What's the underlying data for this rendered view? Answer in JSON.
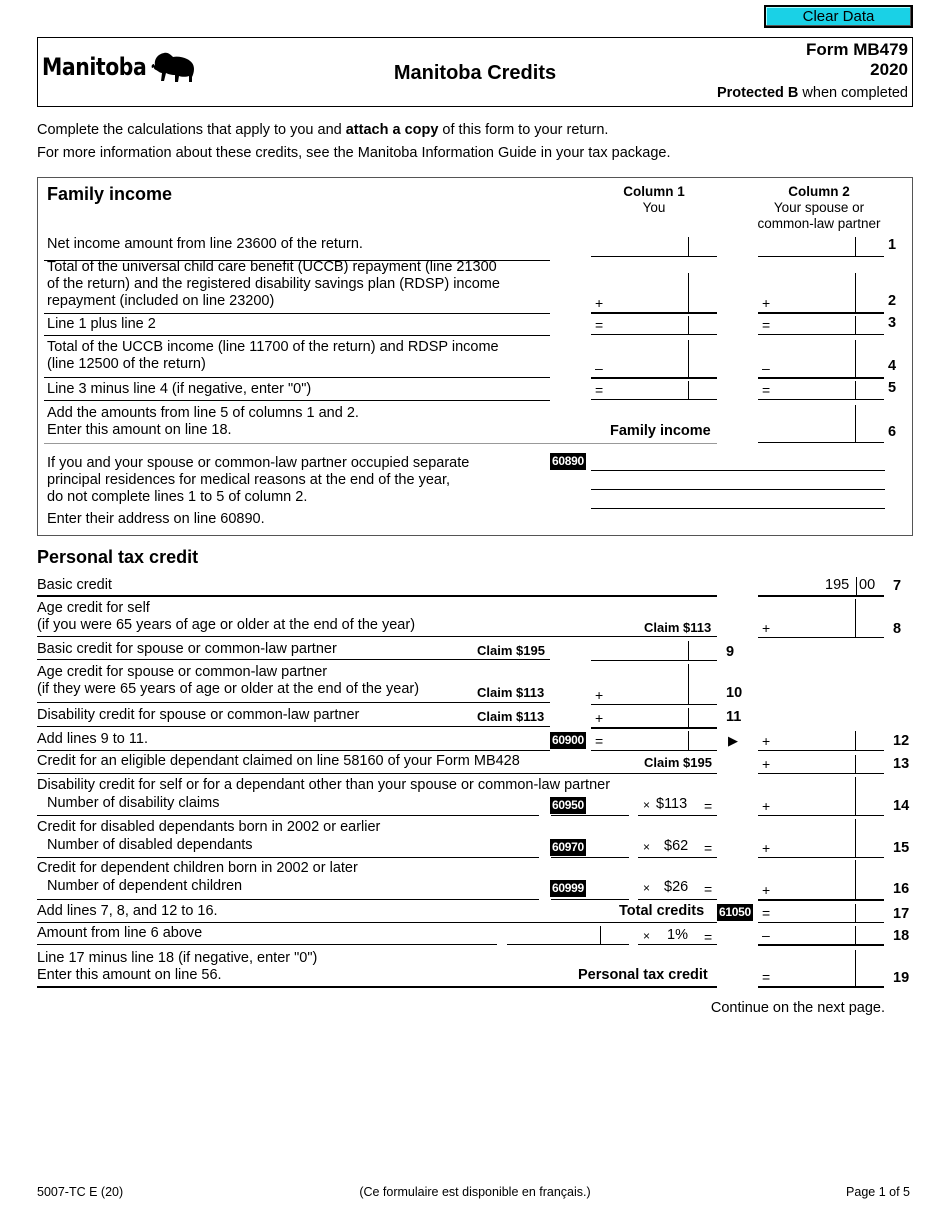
{
  "toolbar": {
    "clear_label": "Clear Data"
  },
  "header": {
    "logo_text": "Manitoba",
    "title": "Manitoba Credits",
    "form_number": "Form MB479",
    "year": "2020",
    "protected_bold": "Protected B",
    "protected_rest": " when completed"
  },
  "intro": {
    "line1_pre": "Complete the calculations that apply to you and ",
    "line1_bold": "attach a copy",
    "line1_post": " of this form to your return.",
    "line2": "For more information about these credits, see the Manitoba Information Guide in your tax package."
  },
  "family": {
    "title": "Family income",
    "col1_title": "Column 1",
    "col1_sub": "You",
    "col2_title": "Column 2",
    "col2_sub1": "Your spouse or",
    "col2_sub2": "common-law partner",
    "lines": [
      {
        "num": "1",
        "text": [
          "Net income amount from line 23600 of the return."
        ],
        "op": "",
        "col1": "",
        "col2": ""
      },
      {
        "num": "2",
        "text": [
          "Total of the universal child care benefit (UCCB) repayment (line 21300",
          "of the return) and the registered disability savings plan (RDSP) income",
          "repayment (included on line 23200)"
        ],
        "op": "+",
        "col1": "",
        "col2": ""
      },
      {
        "num": "3",
        "text": [
          "Line 1 plus line 2"
        ],
        "op": "=",
        "col1": "",
        "col2": ""
      },
      {
        "num": "4",
        "text": [
          "Total of the UCCB income (line 11700 of the return) and RDSP income",
          "(line 12500 of the return)"
        ],
        "op": "–",
        "col1": "",
        "col2": ""
      },
      {
        "num": "5",
        "text": [
          "Line 3 minus line 4 (if negative, enter \"0\")"
        ],
        "op": "=",
        "col1": "",
        "col2": ""
      },
      {
        "num": "6",
        "text": [
          "Add the amounts from line 5 of columns 1 and 2.",
          "Enter this amount on line 18."
        ],
        "label": "Family income",
        "value": ""
      }
    ],
    "separate": {
      "text": [
        "If you and your spouse or common-law partner occupied separate",
        "principal residences for medical reasons at the end of the year,",
        "do not complete lines 1 to 5 of column 2."
      ],
      "text2": "Enter their address on line 60890.",
      "code": "60890",
      "address_lines": [
        "",
        "",
        ""
      ]
    }
  },
  "personal": {
    "title": "Personal tax credit",
    "line7": {
      "num": "7",
      "text": "Basic credit",
      "dollars": "195",
      "cents": "00"
    },
    "line8": {
      "num": "8",
      "text": [
        "Age credit for self",
        "(if you were 65 years of age or older at the end of the year)"
      ],
      "claim": "Claim $113",
      "op": "+",
      "value": ""
    },
    "line9": {
      "num": "9",
      "text": "Basic credit for spouse or common-law partner",
      "claim": "Claim $195",
      "value": ""
    },
    "line10": {
      "num": "10",
      "text": [
        "Age credit for spouse or common-law partner",
        "(if they were 65 years of age or older at the end of the year)"
      ],
      "claim": "Claim $113",
      "op": "+",
      "value": ""
    },
    "line11": {
      "num": "11",
      "text": "Disability credit for spouse or common-law partner",
      "claim": "Claim $113",
      "op": "+",
      "value": ""
    },
    "line12": {
      "num": "12",
      "text": "Add lines 9 to 11.",
      "code": "60900",
      "op": "=",
      "arrow": "▶",
      "op2": "+",
      "value": "",
      "value2": ""
    },
    "line13": {
      "num": "13",
      "text": "Credit for an eligible dependant claimed on line 58160 of your Form MB428",
      "claim": "Claim $195",
      "op": "+",
      "value": ""
    },
    "line14": {
      "num": "14",
      "text": "Disability credit for self or for a dependant other than your spouse or common-law partner",
      "sub": "Number of disability claims",
      "code": "60950",
      "mult": "×",
      "rate": "$113",
      "eq": "=",
      "op": "+",
      "count": "",
      "value": ""
    },
    "line15": {
      "num": "15",
      "text": "Credit for disabled dependants born in 2002 or earlier",
      "sub": "Number of disabled dependants",
      "code": "60970",
      "mult": "×",
      "rate": "$62",
      "eq": "=",
      "op": "+",
      "count": "",
      "value": ""
    },
    "line16": {
      "num": "16",
      "text": "Credit for dependent children born in 2002 or later",
      "sub": "Number of dependent children",
      "code": "60999",
      "mult": "×",
      "rate": "$26",
      "eq": "=",
      "op": "+",
      "count": "",
      "value": ""
    },
    "line17": {
      "num": "17",
      "text": "Add lines 7, 8, and 12 to 16.",
      "label": "Total credits",
      "code": "61050",
      "op": "=",
      "value": ""
    },
    "line18": {
      "num": "18",
      "text": "Amount from line 6 above",
      "mult": "×",
      "rate": "1%",
      "eq": "=",
      "op": "–",
      "amount": "",
      "value": ""
    },
    "line19": {
      "num": "19",
      "text": [
        "Line 17 minus line 18 (if negative, enter \"0\")",
        "Enter this amount on line 56."
      ],
      "label": "Personal tax credit",
      "op": "=",
      "value": ""
    },
    "continue": "Continue on the next page."
  },
  "footer": {
    "form_code": "5007-TC E (20)",
    "french": "(Ce formulaire est disponible en français.)",
    "page": "Page 1 of 5"
  }
}
